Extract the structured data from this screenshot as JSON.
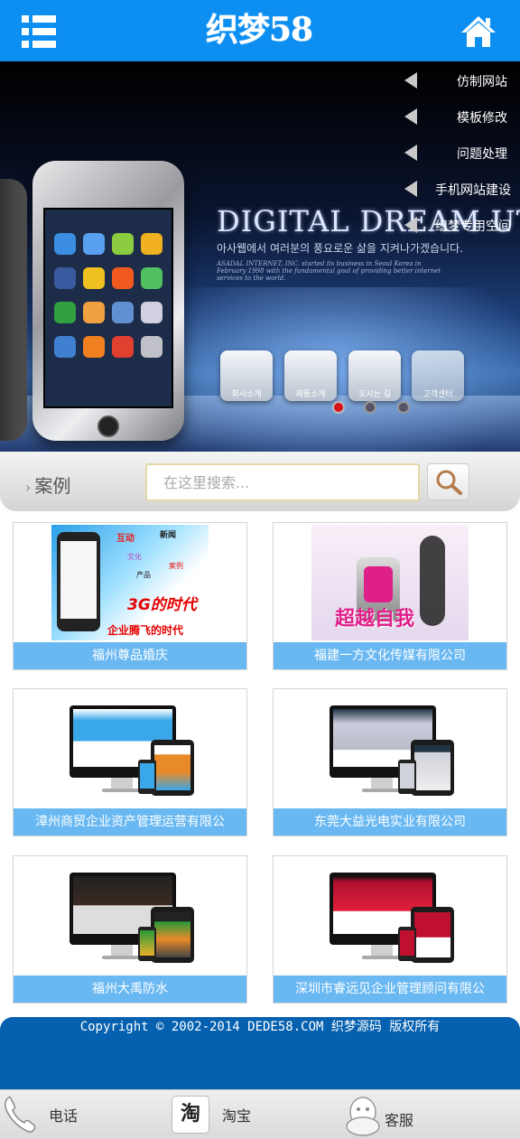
{
  "header": {
    "logo_text": "织梦58",
    "menu_icon": "menu-icon",
    "home_icon": "home-icon",
    "brand_color": "#0d8ff2"
  },
  "banner": {
    "headline": "DIGITAL DREAM UTOPIA",
    "subtitle_korean": "아사웹에서 여러분의 풍요로운 삶을 지켜나가겠습니다.",
    "subtitle_english": "ASADAL INTERNET, INC. started its business in Seoul Korea in February 1998 with the fundamental goal of providing better internet services to the world.",
    "buttons": [
      "회사소개",
      "제품소개",
      "오시는 길",
      "고객센터"
    ],
    "slide_count": 3,
    "active_slide": 1
  },
  "side_menu": [
    "仿制网站",
    "模板修改",
    "问题处理",
    "手机网站建设",
    "织梦专用空间"
  ],
  "search": {
    "section_title": "案例",
    "placeholder": "在这里搜索...",
    "button_icon": "search-icon"
  },
  "cases": [
    {
      "caption": "福州尊品婚庆",
      "image_text": [
        "互动",
        "新闻",
        "文化",
        "产品",
        "案例",
        "3G的时代",
        "企业腾飞的时代"
      ],
      "image_style": "phone-splash"
    },
    {
      "caption": "福建一方文化传媒有限公司",
      "image_text": [
        "超越自我"
      ],
      "image_style": "dancer"
    },
    {
      "caption": "漳州商贸企业资产管理运营有限公",
      "image_style": "devices-blue"
    },
    {
      "caption": "东莞大益光电实业有限公司",
      "image_style": "devices-gray"
    },
    {
      "caption": "福州大禹防水",
      "image_style": "devices-dark"
    },
    {
      "caption": "深圳市睿远见企业管理顾问有限公",
      "image_style": "devices-red"
    }
  ],
  "footer": {
    "copyright": "Copyright © 2002-2014 DEDE58.COM 织梦源码 版权所有",
    "footer_color": "#0561b0"
  },
  "bottom_nav": {
    "phone_label": "电话",
    "taobao_label": "淘宝",
    "taobao_icon_char": "淘",
    "service_label": "客服"
  }
}
